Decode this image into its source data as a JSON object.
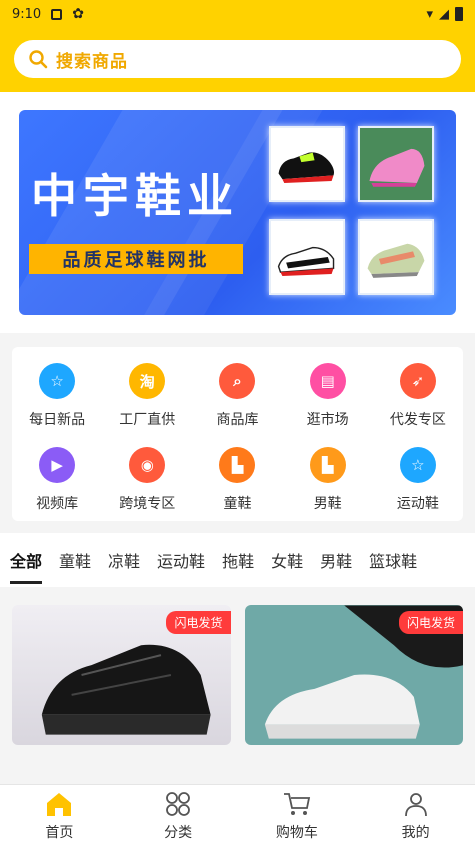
{
  "status_bar": {
    "time": "9:10"
  },
  "search": {
    "placeholder": "搜索商品"
  },
  "banner": {
    "title": "中宇鞋业",
    "subtitle": "品质足球鞋网批"
  },
  "categories": [
    {
      "label": "每日新品",
      "icon": "star-icon",
      "color": "#1ea7ff"
    },
    {
      "label": "工厂直供",
      "icon": "taobao-icon",
      "color": "#ffb700"
    },
    {
      "label": "商品库",
      "icon": "search-goods-icon",
      "color": "#ff5a3c"
    },
    {
      "label": "逛市场",
      "icon": "shop-icon",
      "color": "#ff4fa3"
    },
    {
      "label": "代发专区",
      "icon": "rocket-icon",
      "color": "#ff5a3c"
    },
    {
      "label": "视频库",
      "icon": "video-icon",
      "color": "#8b5cf6"
    },
    {
      "label": "跨境专区",
      "icon": "cross-border-icon",
      "color": "#ff5a3c"
    },
    {
      "label": "童鞋",
      "icon": "boot-icon",
      "color": "#ff7a1a"
    },
    {
      "label": "男鞋",
      "icon": "boot-icon",
      "color": "#ff9a1a"
    },
    {
      "label": "运动鞋",
      "icon": "star-icon",
      "color": "#1ea7ff"
    }
  ],
  "tabs": [
    "全部",
    "童鞋",
    "凉鞋",
    "运动鞋",
    "拖鞋",
    "女鞋",
    "男鞋",
    "篮球鞋"
  ],
  "products": [
    {
      "badge": "闪电发货"
    },
    {
      "badge": "闪电发货"
    }
  ],
  "tabbar": [
    {
      "label": "首页",
      "icon": "home-icon"
    },
    {
      "label": "分类",
      "icon": "category-icon"
    },
    {
      "label": "购物车",
      "icon": "cart-icon"
    },
    {
      "label": "我的",
      "icon": "user-icon"
    }
  ]
}
